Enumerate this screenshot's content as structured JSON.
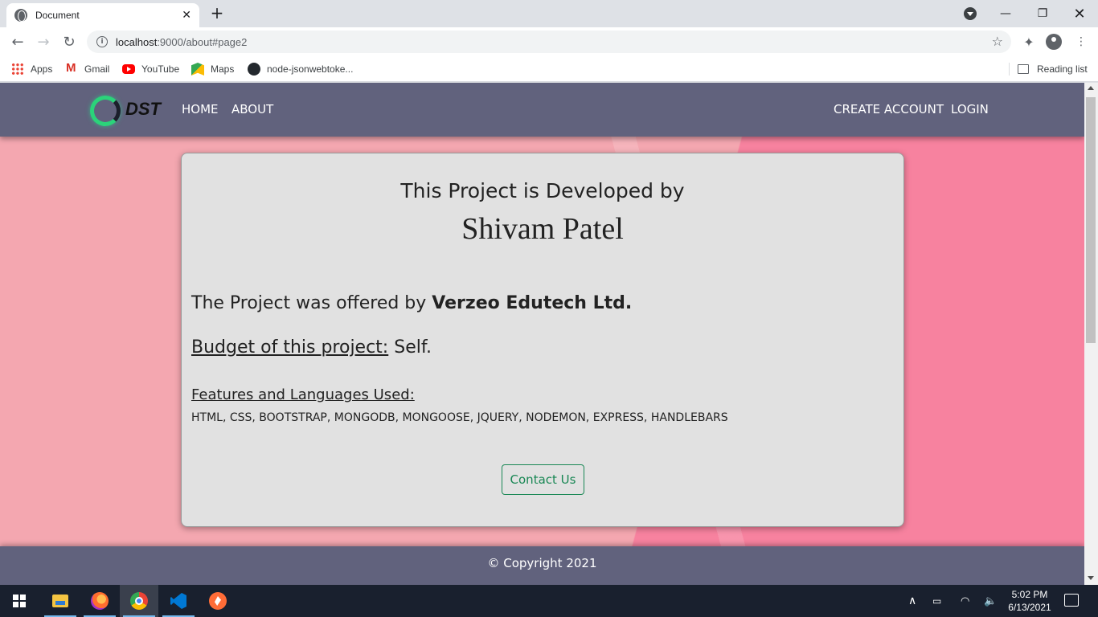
{
  "browser": {
    "tab_title": "Document",
    "url_host": "localhost",
    "url_rest": ":9000/about#page2",
    "bookmarks": [
      "Apps",
      "Gmail",
      "YouTube",
      "Maps",
      "node-jsonwebtoke..."
    ],
    "reading_list": "Reading list"
  },
  "navbar": {
    "brand": "DST",
    "links_left": [
      "HOME",
      "ABOUT"
    ],
    "links_right": [
      "CREATE ACCOUNT",
      "LOGIN"
    ]
  },
  "card": {
    "heading": "This Project is Developed by",
    "developer": "Shivam Patel",
    "offered_prefix": "The Project was offered by ",
    "offered_company": "Verzeo Edutech Ltd.",
    "budget_label": "Budget of this project:",
    "budget_value": " Self.",
    "features_label": "Features and Languages Used:",
    "features_list": "HTML, CSS, BOOTSTRAP, MONGODB, MONGOOSE, JQUERY, NODEMON, EXPRESS, HANDLEBARS",
    "contact_button": "Contact Us"
  },
  "footer": {
    "copyright": "© Copyright 2021"
  },
  "taskbar": {
    "time": "5:02 PM",
    "date": "6/13/2021"
  },
  "colors": {
    "navbar_bg": "#61627d",
    "card_bg": "#e1e1e1",
    "page_bg_left": "#f4a7b0",
    "page_bg_right": "#f7829f",
    "contact_accent": "#198754"
  }
}
